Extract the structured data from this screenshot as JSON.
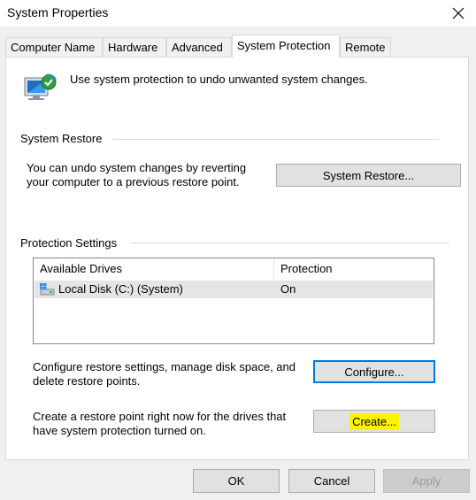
{
  "window": {
    "title": "System Properties"
  },
  "tabs": [
    {
      "label": "Computer Name"
    },
    {
      "label": "Hardware"
    },
    {
      "label": "Advanced"
    },
    {
      "label": "System Protection",
      "active": true
    },
    {
      "label": "Remote"
    }
  ],
  "intro": {
    "text": "Use system protection to undo unwanted system changes."
  },
  "system_restore": {
    "heading": "System Restore",
    "description_line1": "You can undo system changes by reverting",
    "description_line2": "your computer to a previous restore point.",
    "button_label": "System Restore..."
  },
  "protection": {
    "heading": "Protection Settings",
    "columns": [
      "Available Drives",
      "Protection"
    ],
    "drives": [
      {
        "name": "Local Disk (C:) (System)",
        "protection": "On",
        "selected": true
      }
    ],
    "configure_line1": "Configure restore settings, manage disk space, and",
    "configure_line2": "delete restore points.",
    "configure_label": "Configure...",
    "create_line1": "Create a restore point right now for the drives that",
    "create_line2": "have system protection turned on.",
    "create_label": "Create..."
  },
  "footer": {
    "ok_label": "OK",
    "cancel_label": "Cancel",
    "apply_label": "Apply"
  },
  "colors": {
    "focus_border": "#0078d7",
    "highlight": "#fff200",
    "selected_row": "#e5e5e5"
  }
}
